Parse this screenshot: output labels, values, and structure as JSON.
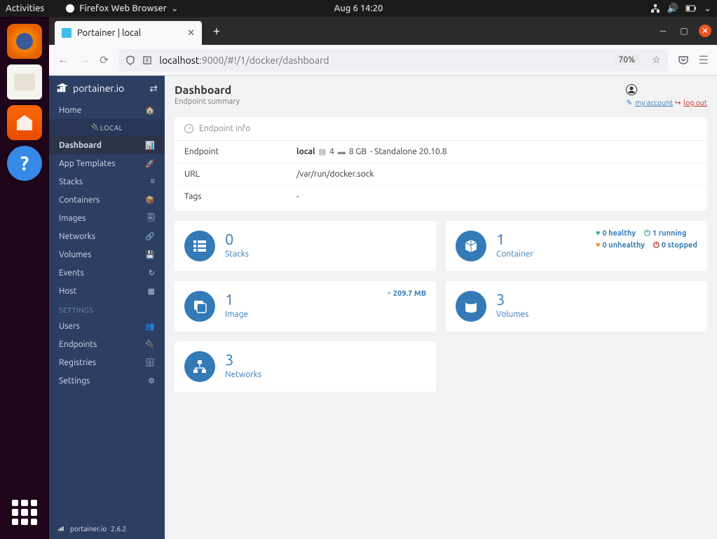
{
  "gnome": {
    "activities": "Activities",
    "app": "Firefox Web Browser",
    "clock": "Aug 6  14:20"
  },
  "firefox": {
    "tab_title": "Portainer | local",
    "url_host": "localhost",
    "url_path": ":9000/#!/1/docker/dashboard",
    "zoom": "70%"
  },
  "sidebar": {
    "brand": "portainer.io",
    "items": [
      {
        "label": "Home",
        "icon": "🏠"
      },
      {
        "label": "LOCAL",
        "sub": true,
        "icon": "🔌"
      },
      {
        "label": "Dashboard",
        "icon": "📊",
        "active": true
      },
      {
        "label": "App Templates",
        "icon": "🚀"
      },
      {
        "label": "Stacks",
        "icon": "≡"
      },
      {
        "label": "Containers",
        "icon": "📦"
      },
      {
        "label": "Images",
        "icon": "🗐"
      },
      {
        "label": "Networks",
        "icon": "🔗"
      },
      {
        "label": "Volumes",
        "icon": "💾"
      },
      {
        "label": "Events",
        "icon": "↻"
      },
      {
        "label": "Host",
        "icon": "▦"
      }
    ],
    "section": "SETTINGS",
    "settings_items": [
      {
        "label": "Users",
        "icon": "👥"
      },
      {
        "label": "Endpoints",
        "icon": "🔌"
      },
      {
        "label": "Registries",
        "icon": "🗄"
      },
      {
        "label": "Settings",
        "icon": "⚙"
      }
    ],
    "footer_brand": "portainer.io",
    "version": "2.6.2"
  },
  "header": {
    "title": "Dashboard",
    "subtitle": "Endpoint summary",
    "my_account": "my account",
    "log_out": "log out"
  },
  "endpoint": {
    "panel_title": "Endpoint info",
    "rows": {
      "endpoint_label": "Endpoint",
      "endpoint_name": "local",
      "cpu_count": "4",
      "memory": "8 GB",
      "mode": "- Standalone 20.10.8",
      "url_label": "URL",
      "url_value": "/var/run/docker.sock",
      "tags_label": "Tags",
      "tags_value": "-"
    }
  },
  "tiles": {
    "stacks": {
      "count": "0",
      "label": "Stacks"
    },
    "containers": {
      "count": "1",
      "label": "Container",
      "healthy": "0 healthy",
      "unhealthy": "0 unhealthy",
      "running": "1 running",
      "stopped": "0 stopped"
    },
    "images": {
      "count": "1",
      "label": "Image",
      "size": "209.7 MB"
    },
    "volumes": {
      "count": "3",
      "label": "Volumes"
    },
    "networks": {
      "count": "3",
      "label": "Networks"
    }
  }
}
